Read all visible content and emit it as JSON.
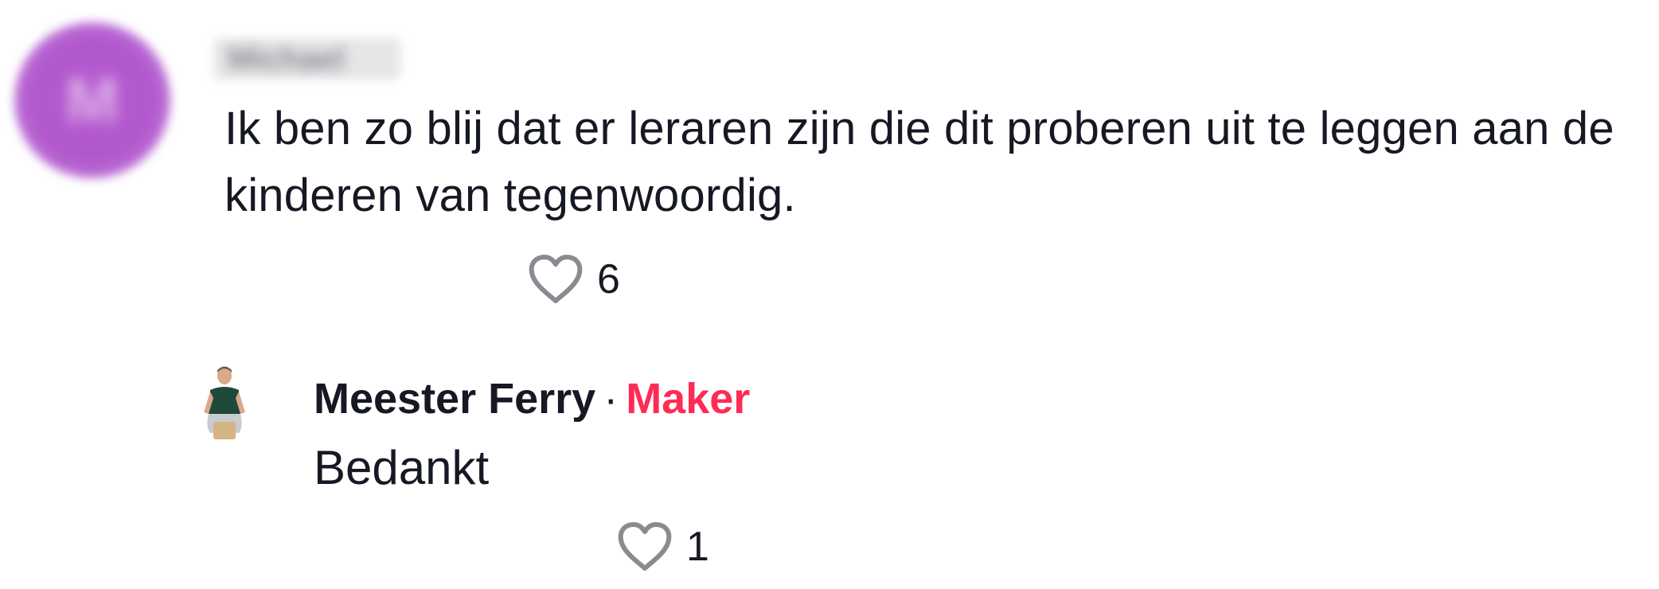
{
  "comment": {
    "author_initial": "M",
    "author_name": "Michael",
    "text": "Ik ben zo blij dat er leraren zijn die dit proberen uit te leggen aan de kinderen van tegenwoordig.",
    "likes": "6",
    "avatar_color": "#b158cd"
  },
  "reply": {
    "author_name": "Meester Ferry",
    "separator": "·",
    "badge": "Maker",
    "badge_color": "#fe2c55",
    "text": "Bedankt",
    "likes": "1"
  },
  "icons": {
    "like": "heart-outline-icon"
  }
}
